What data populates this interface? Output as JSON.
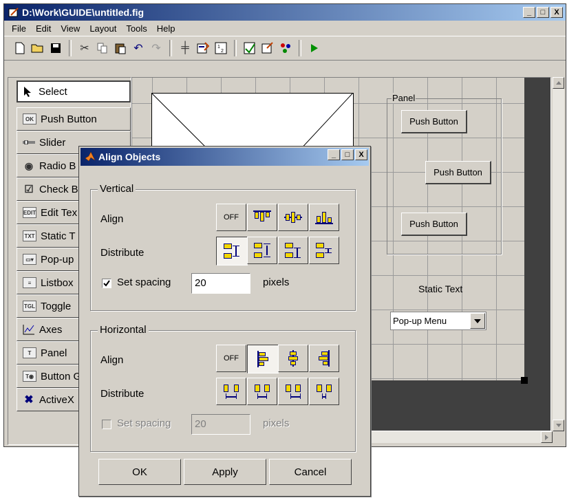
{
  "window": {
    "title": "D:\\Work\\GUIDE\\untitled.fig",
    "minimize": "_",
    "maximize": "□",
    "close": "X"
  },
  "menu": [
    "File",
    "Edit",
    "View",
    "Layout",
    "Tools",
    "Help"
  ],
  "toolbar": [
    "new-file-icon",
    "open-folder-icon",
    "save-icon",
    "cut-icon",
    "copy-icon",
    "paste-icon",
    "undo-icon",
    "redo-icon",
    "align-icon",
    "menu-editor-icon",
    "tab-order-icon",
    "m-file-editor-icon",
    "property-inspector-icon",
    "object-browser-icon",
    "run-icon"
  ],
  "palette": [
    {
      "label": "Select",
      "icon": "arrow-cursor-icon"
    },
    {
      "label": "Push Button",
      "icon": "push-button-icon"
    },
    {
      "label": "Slider",
      "icon": "slider-icon"
    },
    {
      "label": "Radio B",
      "icon": "radio-button-icon"
    },
    {
      "label": "Check B",
      "icon": "checkbox-icon"
    },
    {
      "label": "Edit Tex",
      "icon": "edit-text-icon"
    },
    {
      "label": "Static T",
      "icon": "static-text-icon"
    },
    {
      "label": "Pop-up",
      "icon": "popup-menu-icon"
    },
    {
      "label": "Listbox",
      "icon": "listbox-icon"
    },
    {
      "label": "Toggle",
      "icon": "toggle-button-icon"
    },
    {
      "label": "Axes",
      "icon": "axes-icon"
    },
    {
      "label": "Panel",
      "icon": "panel-icon"
    },
    {
      "label": "Button G",
      "icon": "button-group-icon"
    },
    {
      "label": "ActiveX",
      "icon": "activex-icon"
    }
  ],
  "canvas": {
    "panel_title": "Panel",
    "push1": "Push Button",
    "push2": "Push Button",
    "push3": "Push Button",
    "static_text": "Static Text",
    "popup": "Pop-up Menu"
  },
  "dialog": {
    "title": "Align Objects",
    "vertical": {
      "title": "Vertical",
      "align_label": "Align",
      "distribute_label": "Distribute",
      "off": "OFF",
      "set_spacing_label": "Set spacing",
      "set_spacing_checked": true,
      "spacing_value": "20",
      "units": "pixels"
    },
    "horizontal": {
      "title": "Horizontal",
      "align_label": "Align",
      "distribute_label": "Distribute",
      "off": "OFF",
      "set_spacing_label": "Set spacing",
      "set_spacing_checked": false,
      "spacing_value": "20",
      "units": "pixels"
    },
    "ok": "OK",
    "apply": "Apply",
    "cancel": "Cancel"
  }
}
